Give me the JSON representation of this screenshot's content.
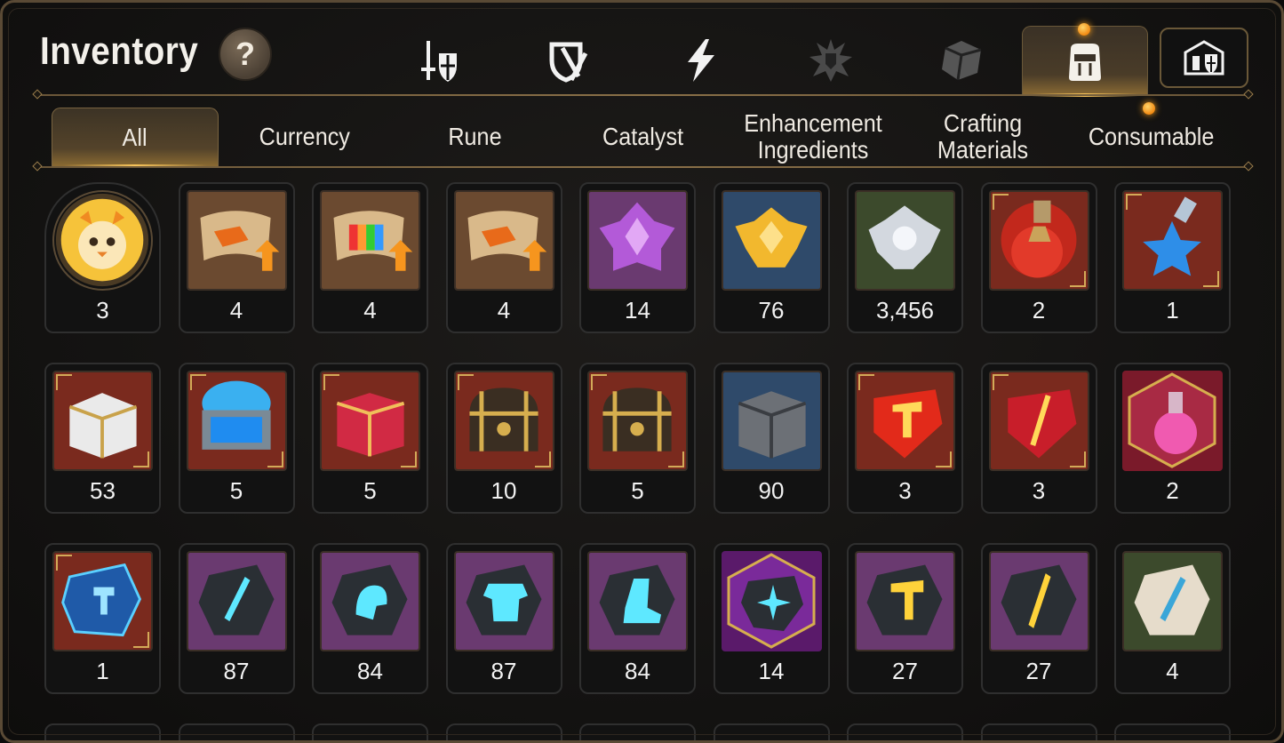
{
  "header": {
    "title": "Inventory",
    "help_label": "?"
  },
  "category_tabs": [
    {
      "icon": "sword-shield-icon",
      "active": false
    },
    {
      "icon": "broken-shield-icon",
      "active": false
    },
    {
      "icon": "lightning-icon",
      "active": false
    },
    {
      "icon": "splash-emblem-icon",
      "active": false
    },
    {
      "icon": "cube-icon",
      "active": false
    },
    {
      "icon": "backpack-icon",
      "active": true
    }
  ],
  "guild_button_icon": "castle-shield-icon",
  "sub_tabs": [
    {
      "label": "All",
      "active": true
    },
    {
      "label": "Currency",
      "active": false
    },
    {
      "label": "Rune",
      "active": false
    },
    {
      "label": "Catalyst",
      "active": false
    },
    {
      "label": "Enhancement Ingredients",
      "active": false
    },
    {
      "label": "Crafting Materials",
      "active": false
    },
    {
      "label": "Consumable",
      "active": false
    }
  ],
  "items": [
    {
      "count": "3",
      "icon": "phoenix-avatar-icon",
      "bg": "#7a5a2a"
    },
    {
      "count": "4",
      "icon": "scroll-upgrade-icon",
      "bg": "#6b4a30"
    },
    {
      "count": "4",
      "icon": "rainbow-scroll-icon",
      "bg": "#6b4a30"
    },
    {
      "count": "4",
      "icon": "scroll-upgrade-icon",
      "bg": "#6b4a30"
    },
    {
      "count": "14",
      "icon": "purple-crystal-icon",
      "bg": "#6a3a70"
    },
    {
      "count": "76",
      "icon": "gold-crystal-icon",
      "bg": "#2f4a6a"
    },
    {
      "count": "3,456",
      "icon": "silver-crystal-icon",
      "bg": "#3c4a2c"
    },
    {
      "count": "2",
      "icon": "red-potion-icon",
      "bg": "#7a2a1e"
    },
    {
      "count": "1",
      "icon": "blue-star-potion-icon",
      "bg": "#7a2a1e"
    },
    {
      "count": "53",
      "icon": "white-chest-icon",
      "bg": "#7a2a1e"
    },
    {
      "count": "5",
      "icon": "blue-chest-icon",
      "bg": "#7a2a1e"
    },
    {
      "count": "5",
      "icon": "red-chest-icon",
      "bg": "#7a2a1e"
    },
    {
      "count": "10",
      "icon": "gold-chest-icon",
      "bg": "#7a2a1e"
    },
    {
      "count": "5",
      "icon": "gold-chest-icon",
      "bg": "#7a2a1e"
    },
    {
      "count": "90",
      "icon": "steel-chest-icon",
      "bg": "#2f4a6a"
    },
    {
      "count": "3",
      "icon": "red-hammer-gem-icon",
      "bg": "#7a2a1e"
    },
    {
      "count": "3",
      "icon": "red-blade-gem-icon",
      "bg": "#7a2a1e"
    },
    {
      "count": "2",
      "icon": "pink-potion-icon",
      "bg": "#7a2a1e"
    },
    {
      "count": "1",
      "icon": "blue-rune-stone-icon",
      "bg": "#7a2a1e"
    },
    {
      "count": "87",
      "icon": "sword-stone-icon",
      "bg": "#6a3a70"
    },
    {
      "count": "84",
      "icon": "helmet-stone-icon",
      "bg": "#6a3a70"
    },
    {
      "count": "87",
      "icon": "armor-stone-icon",
      "bg": "#6a3a70"
    },
    {
      "count": "84",
      "icon": "boot-stone-icon",
      "bg": "#6a3a70"
    },
    {
      "count": "14",
      "icon": "star-stone-icon",
      "bg": "#6a2a7a"
    },
    {
      "count": "27",
      "icon": "gold-hammer-stone-icon",
      "bg": "#6a3a70"
    },
    {
      "count": "27",
      "icon": "gold-blade-stone-icon",
      "bg": "#6a3a70"
    },
    {
      "count": "4",
      "icon": "pale-sword-stone-icon",
      "bg": "#3c4a2c"
    }
  ]
}
